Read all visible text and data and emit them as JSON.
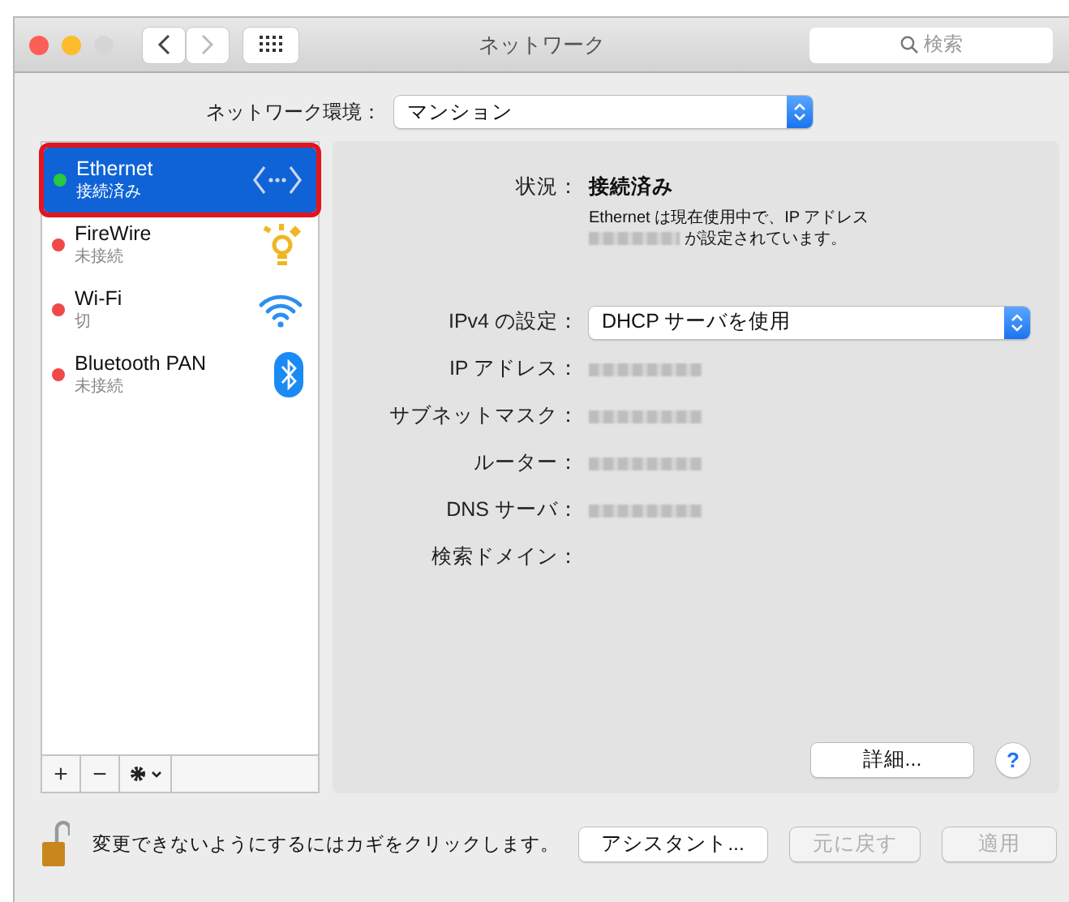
{
  "window": {
    "title": "ネットワーク",
    "search": {
      "placeholder": "検索"
    }
  },
  "location": {
    "label": "ネットワーク環境：",
    "value": "マンション"
  },
  "services": [
    {
      "name": "Ethernet",
      "status": "接続済み",
      "color": "#28c840",
      "selected": true,
      "kind": "ethernet"
    },
    {
      "name": "FireWire",
      "status": "未接続",
      "color": "#f04848",
      "selected": false,
      "kind": "firewire"
    },
    {
      "name": "Wi-Fi",
      "status": "切",
      "color": "#f04848",
      "selected": false,
      "kind": "wifi"
    },
    {
      "name": "Bluetooth PAN",
      "status": "未接続",
      "color": "#f04848",
      "selected": false,
      "kind": "bluetooth"
    }
  ],
  "detail": {
    "status_label": "状況：",
    "status_value": "接続済み",
    "description_line_1": "Ethernet は現在使用中で、IP アドレス",
    "description_line_2": "が設定されています。",
    "fields": [
      {
        "label": "IPv4 の設定：",
        "kind": "select",
        "value": "DHCP サーバを使用"
      },
      {
        "label": "IP アドレス：",
        "kind": "redacted"
      },
      {
        "label": "サブネットマスク：",
        "kind": "redacted"
      },
      {
        "label": "ルーター：",
        "kind": "redacted"
      },
      {
        "label": "DNS サーバ：",
        "kind": "redacted"
      },
      {
        "label": "検索ドメイン：",
        "kind": "empty"
      }
    ],
    "advanced_button": "詳細...",
    "help_button": "?"
  },
  "sidebar_tools": {
    "add": "+",
    "remove": "−"
  },
  "footer": {
    "lock_text": "変更できないようにするにはカギをクリックします。",
    "buttons": [
      {
        "label": "アシスタント...",
        "disabled": false
      },
      {
        "label": "元に戻す",
        "disabled": true
      },
      {
        "label": "適用",
        "disabled": true
      }
    ]
  }
}
